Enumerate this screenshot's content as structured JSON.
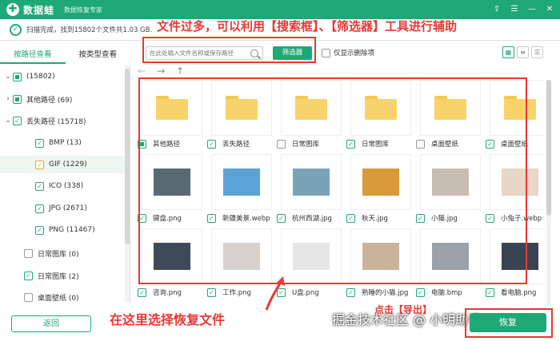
{
  "titlebar": {
    "logo": "✚",
    "app_name": "数据蛙",
    "subtitle": "数据恢复专家",
    "icons": [
      "share-icon",
      "menu-icon",
      "minimize-icon",
      "close-icon"
    ]
  },
  "status": {
    "text": "扫描完成，找到15802个文件共1.03 GB."
  },
  "annotations": {
    "top": "文件过多，可以利用【搜索框】、【筛选器】工具进行辅助",
    "bottom": "在这里选择恢复文件",
    "click": "点击【导出】"
  },
  "tabs": [
    {
      "label": "按路径查看",
      "active": true
    },
    {
      "label": "按类型查看",
      "active": false
    }
  ],
  "tree": [
    {
      "label": "(15802)",
      "state": "partial",
      "chevron": "down",
      "indent": 0
    },
    {
      "label": "其他路径 (69)",
      "state": "partial",
      "chevron": "right",
      "indent": 1
    },
    {
      "label": "丢失路径 (15718)",
      "state": "checked",
      "chevron": "down",
      "indent": 1
    },
    {
      "label": "BMP (13)",
      "state": "checked",
      "indent": 2
    },
    {
      "label": "GIF (1229)",
      "state": "orange",
      "indent": 2,
      "selected": true
    },
    {
      "label": "ICO (338)",
      "state": "checked",
      "indent": 2
    },
    {
      "label": "JPG (2671)",
      "state": "checked",
      "indent": 2
    },
    {
      "label": "PNG (11467)",
      "state": "checked",
      "indent": 2
    },
    {
      "label": "日常图库 (0)",
      "state": "unchecked",
      "indent": 1
    },
    {
      "label": "日常图库 (2)",
      "state": "checked",
      "indent": 1
    },
    {
      "label": "桌面壁纸 (0)",
      "state": "unchecked",
      "indent": 1
    }
  ],
  "back_button": "返回",
  "search": {
    "placeholder": "在此处输入文件名称或保存路径"
  },
  "filter_button": "筛选器",
  "only_deleted": "仅显示删除项",
  "nav": {
    "back": "←",
    "forward": "→",
    "up": "↑"
  },
  "files": [
    {
      "name": "其他路径",
      "kind": "folder",
      "check": "partial"
    },
    {
      "name": "丢失路径",
      "kind": "folder",
      "check": "checked"
    },
    {
      "name": "日常图库",
      "kind": "folder",
      "check": "unchecked"
    },
    {
      "name": "日常图库",
      "kind": "folder",
      "check": "checked"
    },
    {
      "name": "桌面壁纸",
      "kind": "folder",
      "check": "unchecked"
    },
    {
      "name": "桌面壁纸",
      "kind": "folder",
      "check": "checked"
    },
    {
      "name": "键盘.png",
      "kind": "photo",
      "color": "#5a6a72",
      "check": "checked"
    },
    {
      "name": "新疆美景.webp",
      "kind": "photo",
      "color": "#5ba3d6",
      "check": "checked"
    },
    {
      "name": "杭州西湖.jpg",
      "kind": "photo",
      "color": "#7aa3b8",
      "check": "checked"
    },
    {
      "name": "秋天.jpg",
      "kind": "photo",
      "color": "#d99a3a",
      "check": "checked"
    },
    {
      "name": "小猫.jpg",
      "kind": "photo",
      "color": "#c8bdb2",
      "check": "checked"
    },
    {
      "name": "小兔子.webp",
      "kind": "photo",
      "color": "#e8d6c6",
      "check": "checked"
    },
    {
      "name": "咨询.png",
      "kind": "photo",
      "color": "#3f4a58",
      "check": "checked"
    },
    {
      "name": "工作.png",
      "kind": "photo",
      "color": "#d8d2ce",
      "check": "checked"
    },
    {
      "name": "U盘.png",
      "kind": "photo",
      "color": "#e6e6e6",
      "check": "checked"
    },
    {
      "name": "熟睡的小猫.jpg",
      "kind": "photo",
      "color": "#c9b49a",
      "check": "checked"
    },
    {
      "name": "电脑.bmp",
      "kind": "photo",
      "color": "#9aa2a8",
      "check": "checked"
    },
    {
      "name": "看电脑.png",
      "kind": "photo",
      "color": "#394452",
      "check": "checked"
    }
  ],
  "watermark": "掘金技术社区 @ 小明助手",
  "recover_button": "恢复"
}
